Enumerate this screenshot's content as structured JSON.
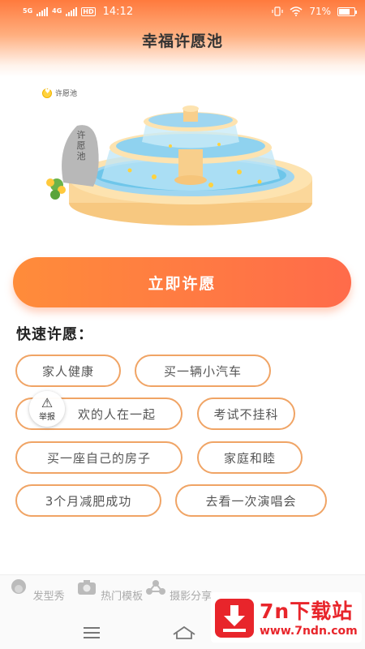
{
  "status_bar": {
    "net1": "5G",
    "net2": "4G",
    "hd": "HD",
    "time": "14:12",
    "battery": "71%",
    "battery_level": 0.71
  },
  "page": {
    "title": "幸福许愿池"
  },
  "illustration": {
    "tag_label": "许愿池",
    "stone_text": [
      "许",
      "愿",
      "池"
    ]
  },
  "main_button": {
    "label": "立即许愿"
  },
  "quick_wishes": {
    "title": "快速许愿：",
    "items": [
      "家人健康",
      "买一辆小汽车",
      "欢的人在一起",
      "考试不挂科",
      "买一座自己的房子",
      "家庭和睦",
      "3个月减肥成功",
      "去看一次演唱会"
    ]
  },
  "report_button": {
    "label": "举报"
  },
  "bottom_nav": {
    "items": [
      {
        "label": "发型秀",
        "icon": "hair-icon"
      },
      {
        "label": "热门模板",
        "icon": "camera-icon"
      },
      {
        "label": "摄影分享",
        "icon": "share-icon"
      }
    ]
  },
  "watermark": {
    "title": "7n下载站",
    "url": "www.7ndn.com"
  },
  "colors": {
    "accent": "#ff7a3d",
    "chip_border": "#f0a465",
    "watermark_red": "#e8252b"
  }
}
